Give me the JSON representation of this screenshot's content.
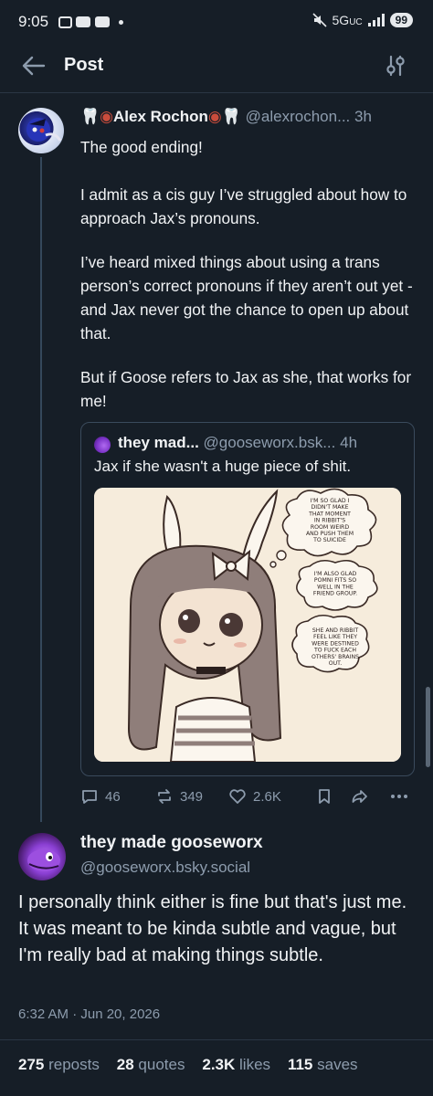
{
  "status_bar": {
    "time": "9:05",
    "network": "5G",
    "network_suffix": "UC",
    "battery": "99"
  },
  "header": {
    "title": "Post"
  },
  "post": {
    "author_name": "Alex Rochon",
    "author_handle": "@alexrochon...",
    "time_ago": "3h",
    "paragraphs": [
      "The good ending!",
      "",
      "I admit as a cis guy I’ve struggled about how to approach Jax’s pronouns.",
      "I’ve heard mixed things about using a trans person’s correct pronouns if they aren’t out yet - and Jax never got the chance to open up about that.",
      "But if Goose refers to Jax as she, that works for me!"
    ],
    "quote": {
      "author_name": "they mad...",
      "author_handle": "@gooseworx.bsk...",
      "time_ago": "4h",
      "text": "Jax if she wasn't a huge piece of shit.",
      "image_bubbles": [
        "I'M SO GLAD I DIDN'T MAKE THAT MOMENT IN RIBBIT'S ROOM WEIRD AND PUSH THEM TO SUICIDE",
        "I'M ALSO GLAD POMNI FITS SO WELL IN THE FRIEND GROUP.",
        "SHE AND RIBBIT FEEL LIKE THEY WERE DESTINED TO FUCK EACH OTHERS' BRAINS OUT."
      ]
    },
    "actions": {
      "replies": "46",
      "reposts": "349",
      "likes": "2.6K"
    }
  },
  "reply": {
    "author_name": "they made gooseworx",
    "author_handle": "@gooseworx.bsky.social",
    "text": "I personally think either is fine but that's just me. It was meant to be kinda subtle and vague, but I'm really bad at making things subtle.",
    "timestamp": "6:32 AM · Jun 20, 2026",
    "stats": {
      "reposts_count": "275",
      "reposts_label": "reposts",
      "quotes_count": "28",
      "quotes_label": "quotes",
      "likes_count": "2.3K",
      "likes_label": "likes",
      "saves_count": "115",
      "saves_label": "saves"
    }
  },
  "colors": {
    "background": "#161e27",
    "muted": "#8d9cad",
    "text": "#f1f3f5",
    "divider": "#2a3644"
  }
}
